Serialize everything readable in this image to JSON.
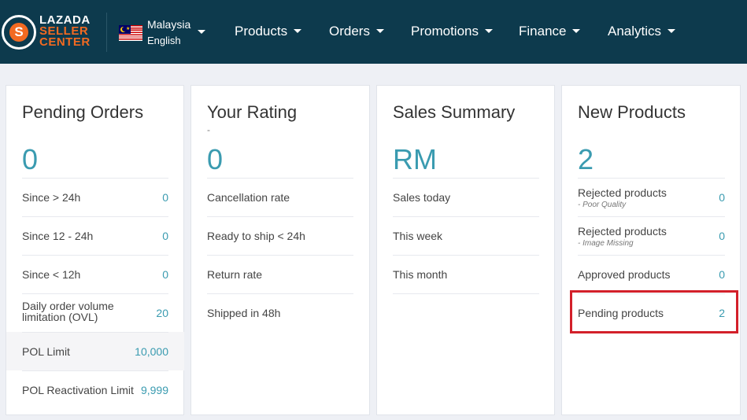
{
  "header": {
    "logo": {
      "line1": "LAZADA",
      "line2": "SELLER",
      "line3": "CENTER",
      "letter": "S"
    },
    "locale": {
      "country": "Malaysia",
      "language": "English",
      "flag": "malaysia-flag"
    },
    "nav": [
      {
        "label": "Products"
      },
      {
        "label": "Orders"
      },
      {
        "label": "Promotions"
      },
      {
        "label": "Finance"
      },
      {
        "label": "Analytics"
      }
    ],
    "colors": {
      "bar": "#0d3a4d",
      "brand_orange": "#f26a21"
    }
  },
  "cards": {
    "pending_orders": {
      "title": "Pending Orders",
      "value": "0",
      "rows": [
        {
          "label": "Since > 24h",
          "value": "0"
        },
        {
          "label": "Since 12 - 24h",
          "value": "0"
        },
        {
          "label": "Since < 12h",
          "value": "0"
        },
        {
          "label": "Daily order volume limitation (OVL)",
          "value": "20"
        },
        {
          "label": "POL Limit",
          "value": "10,000"
        },
        {
          "label": "POL Reactivation Limit",
          "value": "9,999"
        }
      ]
    },
    "your_rating": {
      "title": "Your Rating",
      "subtitle": "-",
      "value": "0",
      "rows": [
        {
          "label": "Cancellation rate"
        },
        {
          "label": "Ready to ship < 24h"
        },
        {
          "label": "Return rate"
        },
        {
          "label": "Shipped in 48h"
        }
      ]
    },
    "sales_summary": {
      "title": "Sales Summary",
      "value": "RM",
      "rows": [
        {
          "label": "Sales today"
        },
        {
          "label": "This week"
        },
        {
          "label": "This month"
        }
      ]
    },
    "new_products": {
      "title": "New Products",
      "value": "2",
      "rows": [
        {
          "label": "Rejected products",
          "sub": "- Poor Quality",
          "value": "0"
        },
        {
          "label": "Rejected products",
          "sub": "- Image Missing",
          "value": "0"
        },
        {
          "label": "Approved products",
          "value": "0"
        },
        {
          "label": "Pending products",
          "value": "2"
        }
      ]
    }
  },
  "colors": {
    "accent": "#3a9bb0",
    "highlight_border": "#d3202a",
    "page_bg": "#eef0f5"
  }
}
